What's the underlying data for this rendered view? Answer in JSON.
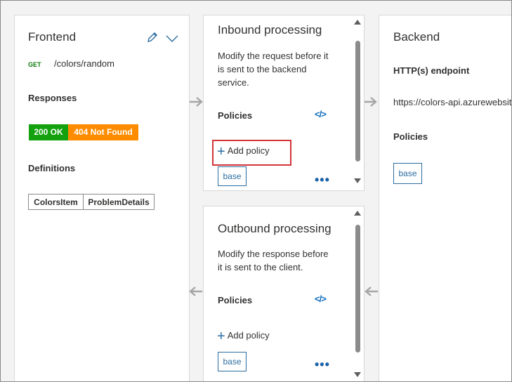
{
  "frontend": {
    "title": "Frontend",
    "method": "GET",
    "path": "/colors/random",
    "responses_label": "Responses",
    "responses": [
      "200 OK",
      "404 Not Found"
    ],
    "definitions_label": "Definitions",
    "definitions": [
      "ColorsItem",
      "ProblemDetails"
    ]
  },
  "inbound": {
    "title": "Inbound processing",
    "description_line1": "Modify the request before it",
    "description_line2": "is sent to the backend",
    "description_line3": "service.",
    "policies_label": "Policies",
    "code_icon": "</>",
    "add_policy": "Add policy",
    "base_tag": "base",
    "more": "•••"
  },
  "outbound": {
    "title": "Outbound processing",
    "description_line1": "Modify the response before",
    "description_line2": "it is sent to the client.",
    "policies_label": "Policies",
    "code_icon": "</>",
    "add_policy": "Add policy",
    "base_tag": "base",
    "more": "•••"
  },
  "backend": {
    "title": "Backend",
    "endpoint_label": "HTTP(s) endpoint",
    "endpoint_url": "https://colors-api.azurewebsit",
    "policies_label": "Policies",
    "base_tag": "base"
  },
  "colors": {
    "ok": "#13a10e",
    "not_found": "#ff8c00",
    "highlight": "#d13438",
    "accent": "#2b6da0"
  }
}
